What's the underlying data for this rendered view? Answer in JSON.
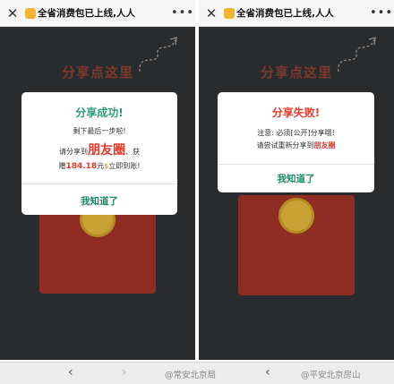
{
  "left": {
    "titlebar": {
      "close_icon": "close-icon",
      "title": "全省消费包已上线,人人",
      "more_icon": "more-icon"
    },
    "share_here": "分享点这里",
    "dialog": {
      "title": "分享成功!",
      "line1": "剩下最后一步啦!",
      "line2_pre": "请分享到",
      "line2_highlight": "朋友圈",
      "line2_post": "、获",
      "line3_pre": "赠",
      "amount": "184.18",
      "unit": "元",
      "line3_post": "立即到账!",
      "ok_label": "我知道了"
    }
  },
  "right": {
    "titlebar": {
      "close_icon": "close-icon",
      "title": "全省消费包已上线,人人",
      "more_icon": "more-icon"
    },
    "share_here": "分享点这里",
    "dialog": {
      "title": "分享失败!",
      "line1": "注意: 必须[公开]分享哦!",
      "line2_pre": "请尝试重新分享到",
      "line2_highlight": "朋友圈",
      "ok_label": "我知道了"
    }
  },
  "bottom": {
    "back": "‹",
    "forward": "›",
    "watermark1": "@常安北京局",
    "watermark2": "@平安北京房山"
  },
  "colors": {
    "success": "#29a07c",
    "fail": "#e8392b",
    "background": "#2a2b2d",
    "envelope": "#8d2d23"
  }
}
